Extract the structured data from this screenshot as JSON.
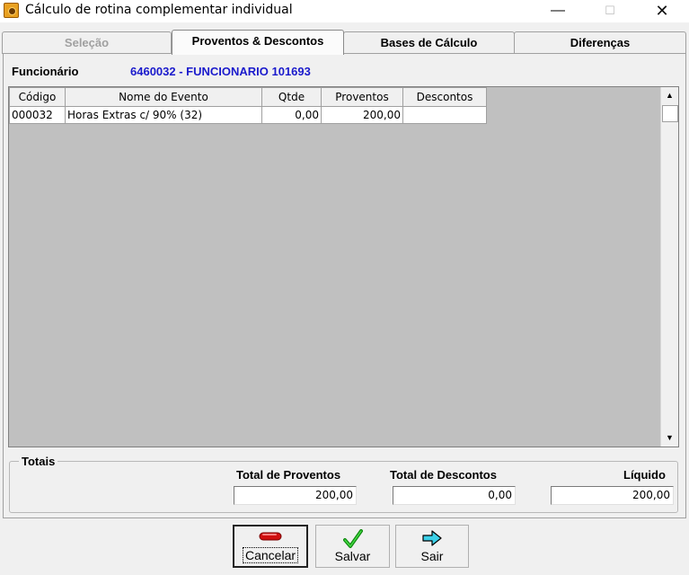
{
  "window": {
    "title": "Cálculo de rotina complementar individual",
    "minimize_glyph": "—",
    "maximize_glyph": "☐",
    "close_glyph": "✕"
  },
  "tabs": [
    {
      "label": "Seleção",
      "state": "disabled"
    },
    {
      "label": "Proventos & Descontos",
      "state": "active"
    },
    {
      "label": "Bases de Cálculo",
      "state": "normal"
    },
    {
      "label": "Diferenças",
      "state": "normal"
    }
  ],
  "employee": {
    "label": "Funcionário",
    "value": "6460032 - FUNCIONARIO 101693",
    "value_color": "#1a1acc"
  },
  "grid": {
    "columns": [
      "Código",
      "Nome do Evento",
      "Qtde",
      "Proventos",
      "Descontos"
    ],
    "rows": [
      {
        "codigo": "000032",
        "nome": "Horas Extras c/ 90% (32)",
        "qtde": "0,00",
        "proventos": "200,00",
        "descontos": ""
      }
    ],
    "scroll_up_glyph": "▲",
    "scroll_down_glyph": "▼"
  },
  "totals": {
    "legend": "Totais",
    "proventos_label": "Total de Proventos",
    "proventos_value": "200,00",
    "descontos_label": "Total de Descontos",
    "descontos_value": "0,00",
    "liquido_label": "Líquido",
    "liquido_value": "200,00"
  },
  "buttons": {
    "cancel_label": "Cancelar",
    "save_label": "Salvar",
    "exit_label": "Sair"
  },
  "icons": {
    "cancel": "red-minus-icon",
    "save": "green-check-icon",
    "exit": "cyan-arrow-right-icon"
  }
}
